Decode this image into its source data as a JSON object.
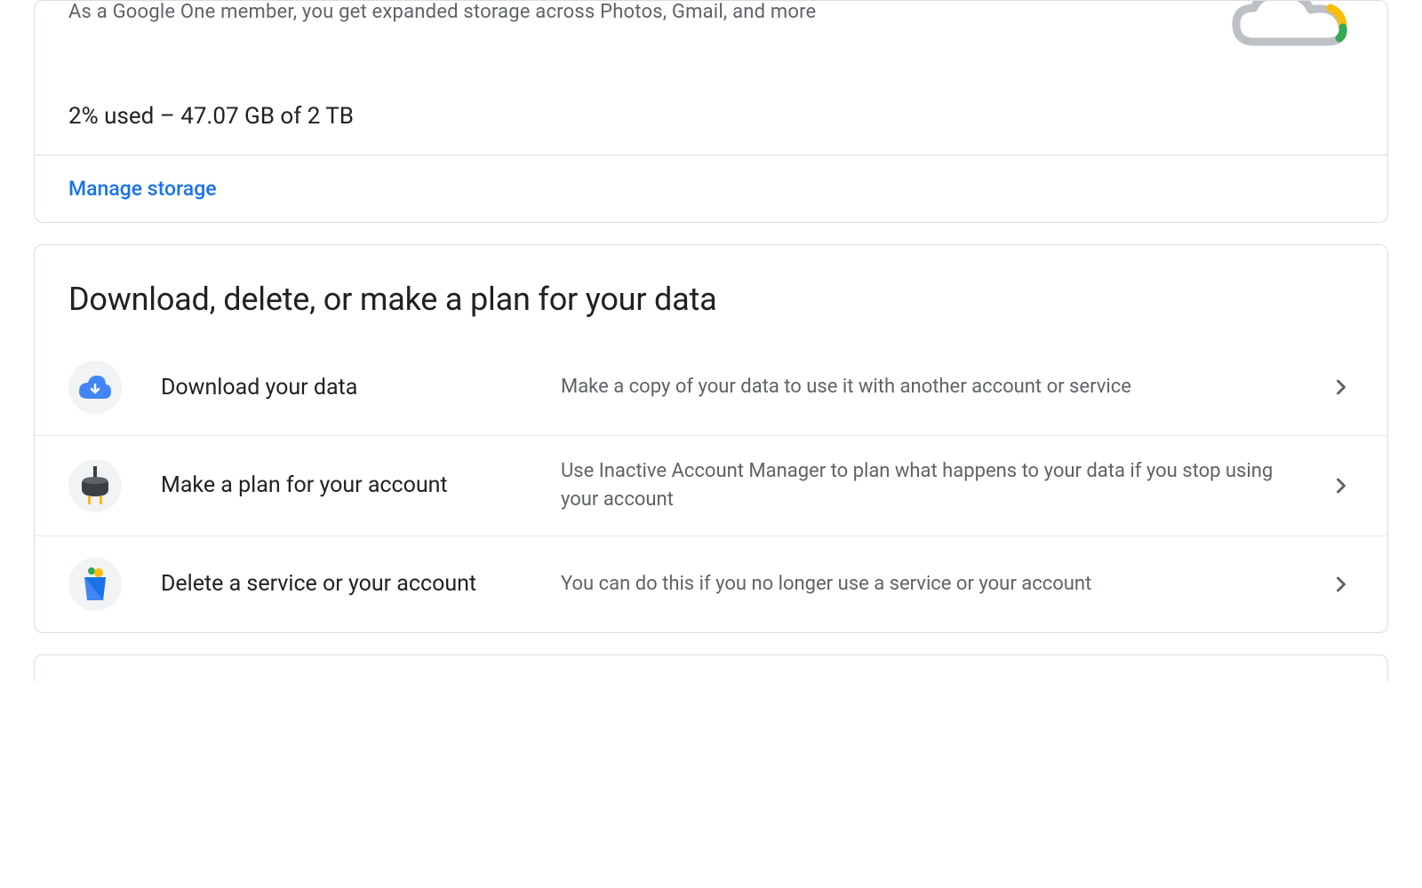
{
  "storage": {
    "subtitle": "As a Google One member, you get expanded storage across Photos, Gmail, and more",
    "usage_text": "2% used – 47.07 GB of 2 TB",
    "manage_link": "Manage storage"
  },
  "data_section": {
    "title": "Download, delete, or make a plan for your data",
    "options": [
      {
        "icon": "cloud-download",
        "label": "Download your data",
        "description": "Make a copy of your data to use it with another account or service"
      },
      {
        "icon": "plug",
        "label": "Make a plan for your account",
        "description": "Use Inactive Account Manager to plan what happens to your data if you stop using your account"
      },
      {
        "icon": "trash",
        "label": "Delete a service or your account",
        "description": "You can do this if you no longer use a service or your account"
      }
    ]
  }
}
